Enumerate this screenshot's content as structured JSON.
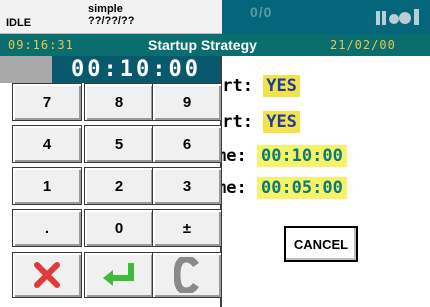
{
  "status": {
    "mode": "IDLE",
    "program_name": "simple",
    "program_step": "??/??/??",
    "counter": "0/0",
    "signal_icon": "signal-bars-icon"
  },
  "titlebar": {
    "time": "09:16:31",
    "title": "Startup Strategy",
    "date": "21/02/00"
  },
  "form": {
    "rows": [
      {
        "label_fragment": "art:",
        "value": "YES"
      },
      {
        "label_fragment": "art:",
        "value": "YES"
      },
      {
        "label_fragment": "me:",
        "value": "00:10:00"
      },
      {
        "label_fragment": "me:",
        "value": "00:05:00"
      }
    ],
    "cancel_label": "CANCEL"
  },
  "keypad": {
    "display_value": "00:10:00",
    "keys": [
      "7",
      "8",
      "9",
      "4",
      "5",
      "6",
      "1",
      "2",
      "3",
      ".",
      "0",
      "±"
    ],
    "action_icons": [
      "cancel-x-icon",
      "enter-arrow-icon",
      "clear-c-icon"
    ],
    "colors": {
      "cancel": "#e23a3a",
      "enter": "#3fba3a",
      "clear": "#8a8a8a"
    }
  }
}
